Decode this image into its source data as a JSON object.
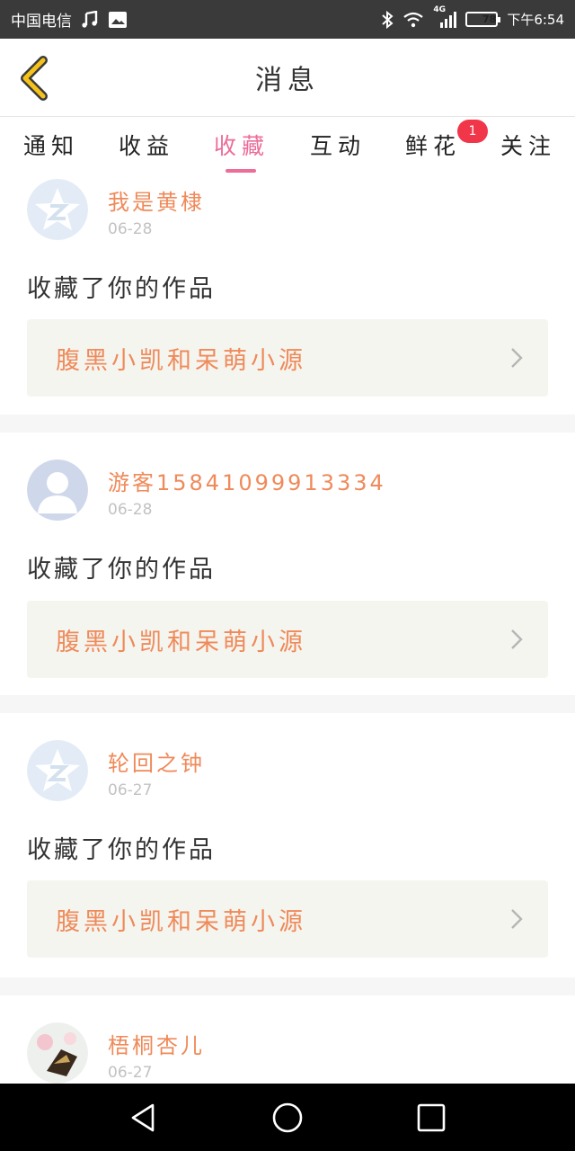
{
  "status_bar": {
    "carrier": "中国电信",
    "network": "4G",
    "battery": "78",
    "time": "下午6:54",
    "icons": [
      "music-icon",
      "image-icon",
      "bluetooth-icon",
      "wifi-icon",
      "signal-icon",
      "battery-icon"
    ]
  },
  "header": {
    "title": "消息",
    "back_icon": "chevron-left-icon",
    "back_color": "#f5c21b"
  },
  "tabs": [
    {
      "label": "通知",
      "active": false
    },
    {
      "label": "收益",
      "active": false
    },
    {
      "label": "收藏",
      "active": true
    },
    {
      "label": "互动",
      "active": false
    },
    {
      "label": "鲜花",
      "active": false,
      "badge": "1"
    },
    {
      "label": "关注",
      "active": false
    }
  ],
  "accent_color": "#ec6c9a",
  "items": [
    {
      "username": "我是黄棣",
      "date": "06-28",
      "action": "收藏了你的作品",
      "work_title": "腹黑小凯和呆萌小源",
      "avatar": "qzone-avatar"
    },
    {
      "username": "游客15841099913334",
      "date": "06-28",
      "action": "收藏了你的作品",
      "work_title": "腹黑小凯和呆萌小源",
      "avatar": "default-user-avatar"
    },
    {
      "username": "轮回之钟",
      "date": "06-27",
      "action": "收藏了你的作品",
      "work_title": "腹黑小凯和呆萌小源",
      "avatar": "qzone-avatar"
    },
    {
      "username": "梧桐杏儿",
      "date": "06-27",
      "action": "",
      "work_title": "",
      "avatar": "photo-avatar"
    }
  ],
  "nav_bar": {
    "icons": [
      "back-triangle-icon",
      "home-circle-icon",
      "recents-square-icon"
    ]
  }
}
